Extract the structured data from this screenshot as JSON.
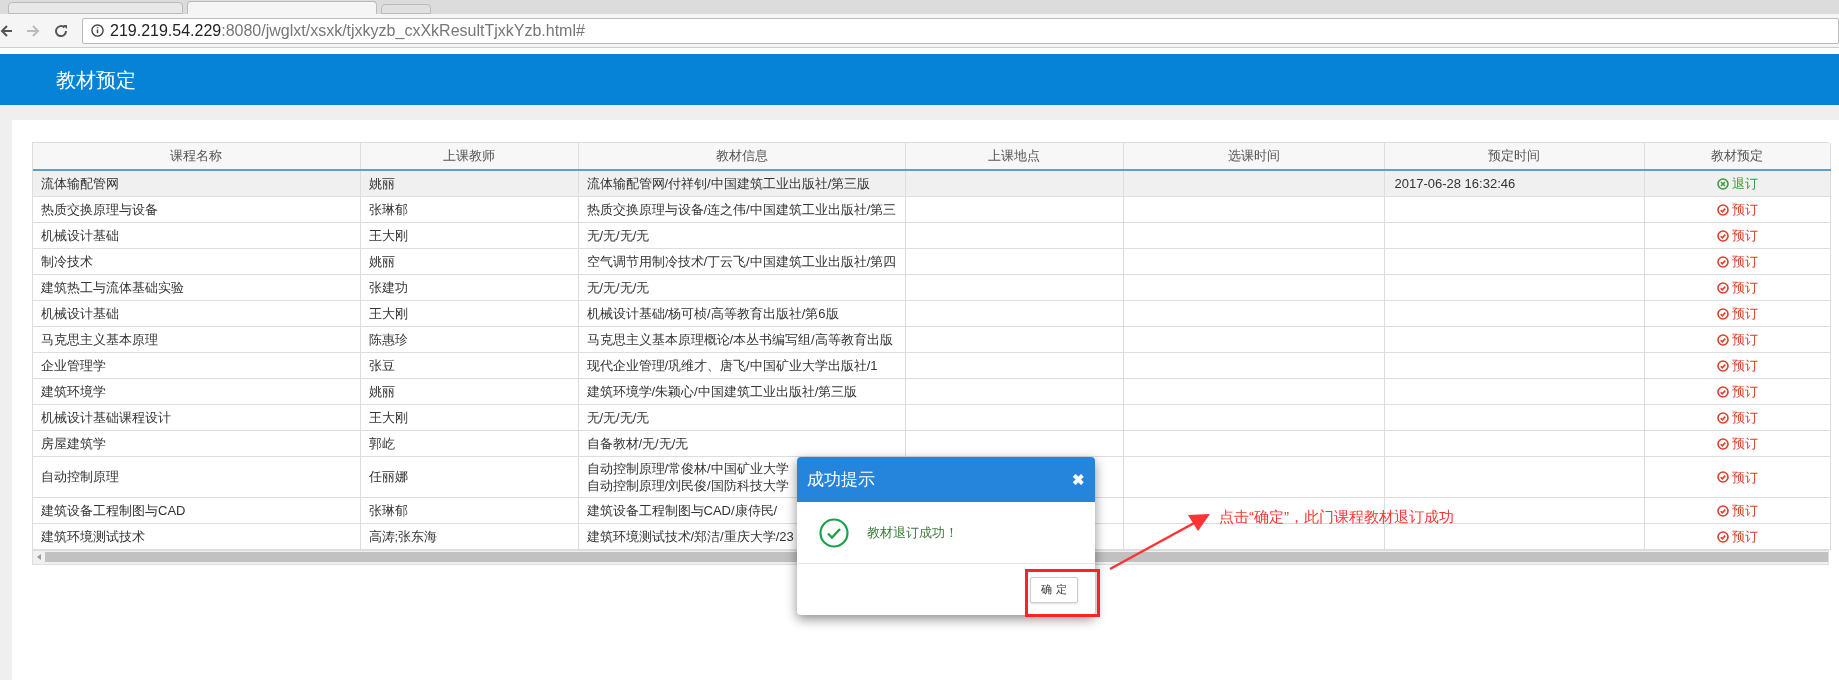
{
  "browser": {
    "url_host": "219.219.54.229",
    "url_path": ":8080/jwglxt/xsxk/tjxkyzb_cxXkResultTjxkYzb.html#"
  },
  "header": {
    "title": "教材预定"
  },
  "table": {
    "columns": [
      "课程名称",
      "上课教师",
      "教材信息",
      "上课地点",
      "选课时间",
      "预定时间",
      "教材预定"
    ],
    "rows": [
      {
        "course": "流体输配管网",
        "teacher": "姚丽",
        "textbook": [
          "流体输配管网/付祥钊/中国建筑工业出版社/第三版"
        ],
        "booked_time": "2017-06-28 16:32:46",
        "action": "退订",
        "booked": true,
        "selected": true
      },
      {
        "course": "热质交换原理与设备",
        "teacher": "张琳郁",
        "textbook": [
          "热质交换原理与设备/连之伟/中国建筑工业出版社/第三"
        ],
        "action": "预订",
        "booked": false,
        "selected": false
      },
      {
        "course": "机械设计基础",
        "teacher": "王大刚",
        "textbook": [
          "无/无/无/无"
        ],
        "action": "预订",
        "booked": false,
        "selected": false
      },
      {
        "course": "制冷技术",
        "teacher": "姚丽",
        "textbook": [
          "空气调节用制冷技术/丁云飞/中国建筑工业出版社/第四"
        ],
        "action": "预订",
        "booked": false,
        "selected": false
      },
      {
        "course": "建筑热工与流体基础实验",
        "teacher": "张建功",
        "textbook": [
          "无/无/无/无"
        ],
        "action": "预订",
        "booked": false,
        "selected": false
      },
      {
        "course": "机械设计基础",
        "teacher": "王大刚",
        "textbook": [
          "机械设计基础/杨可桢/高等教育出版社/第6版"
        ],
        "action": "预订",
        "booked": false,
        "selected": false
      },
      {
        "course": "马克思主义基本原理",
        "teacher": "陈惠珍",
        "textbook": [
          "马克思主义基本原理概论/本丛书编写组/高等教育出版"
        ],
        "action": "预订",
        "booked": false,
        "selected": false
      },
      {
        "course": "企业管理学",
        "teacher": "张豆",
        "textbook": [
          "现代企业管理/巩维才、唐飞/中国矿业大学出版社/1"
        ],
        "action": "预订",
        "booked": false,
        "selected": false
      },
      {
        "course": "建筑环境学",
        "teacher": "姚丽",
        "textbook": [
          "建筑环境学/朱颖心/中国建筑工业出版社/第三版"
        ],
        "action": "预订",
        "booked": false,
        "selected": false
      },
      {
        "course": "机械设计基础课程设计",
        "teacher": "王大刚",
        "textbook": [
          "无/无/无/无"
        ],
        "action": "预订",
        "booked": false,
        "selected": false
      },
      {
        "course": "房屋建筑学",
        "teacher": "郭屹",
        "textbook": [
          "自备教材/无/无/无"
        ],
        "action": "预订",
        "booked": false,
        "selected": false
      },
      {
        "course": "自动控制原理",
        "teacher": "任丽娜",
        "textbook": [
          "自动控制原理/常俊林/中国矿业大学",
          "自动控制原理/刘民俊/国防科技大学"
        ],
        "action": "预订",
        "booked": false,
        "selected": false
      },
      {
        "course": "建筑设备工程制图与CAD",
        "teacher": "张琳郁",
        "textbook": [
          "建筑设备工程制图与CAD/康侍民/"
        ],
        "action": "预订",
        "booked": false,
        "selected": false
      },
      {
        "course": "建筑环境测试技术",
        "teacher": "高涛;张东海",
        "textbook": [
          "建筑环境测试技术/郑洁/重庆大学/23"
        ],
        "action": "预订",
        "booked": false,
        "selected": false
      }
    ]
  },
  "dialog": {
    "title": "成功提示",
    "close": "✖",
    "message": "教材退订成功！",
    "button": "确 定"
  },
  "annotation": {
    "text": "点击“确定”，此门课程教材退订成功"
  }
}
